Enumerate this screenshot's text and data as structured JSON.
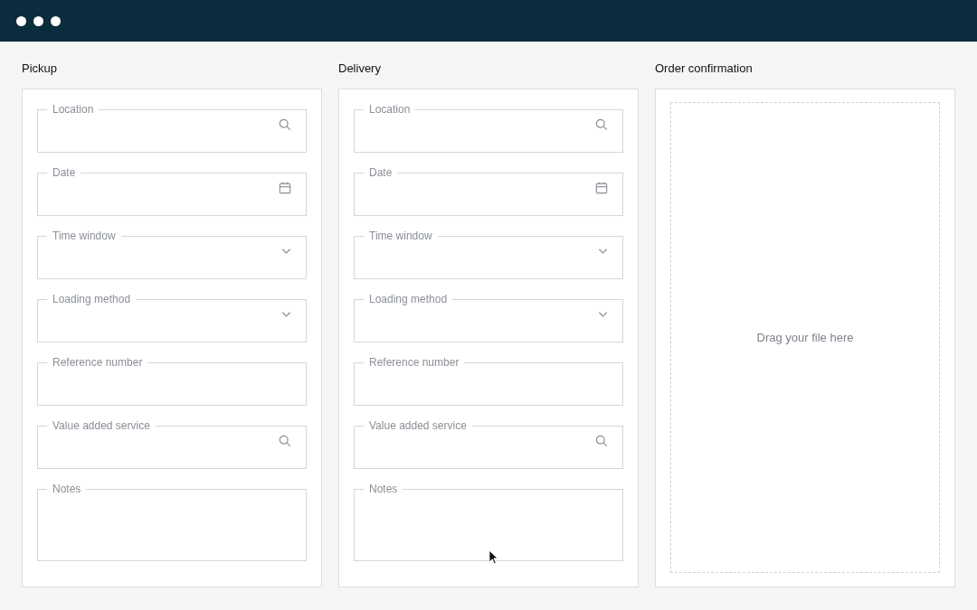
{
  "sections": [
    {
      "title": "Pickup",
      "kind": "form",
      "fields": [
        {
          "label": "Location",
          "kind": "search"
        },
        {
          "label": "Date",
          "kind": "date"
        },
        {
          "label": "Time window",
          "kind": "select"
        },
        {
          "label": "Loading method",
          "kind": "select"
        },
        {
          "label": "Reference number",
          "kind": "text"
        },
        {
          "label": "Value added service",
          "kind": "search"
        },
        {
          "label": "Notes",
          "kind": "textarea"
        }
      ]
    },
    {
      "title": "Delivery",
      "kind": "form",
      "fields": [
        {
          "label": "Location",
          "kind": "search"
        },
        {
          "label": "Date",
          "kind": "date"
        },
        {
          "label": "Time window",
          "kind": "select"
        },
        {
          "label": "Loading method",
          "kind": "select"
        },
        {
          "label": "Reference number",
          "kind": "text"
        },
        {
          "label": "Value added service",
          "kind": "search"
        },
        {
          "label": "Notes",
          "kind": "textarea"
        }
      ]
    },
    {
      "title": "Order confirmation",
      "kind": "upload",
      "dropzone": "Drag your file here"
    }
  ]
}
